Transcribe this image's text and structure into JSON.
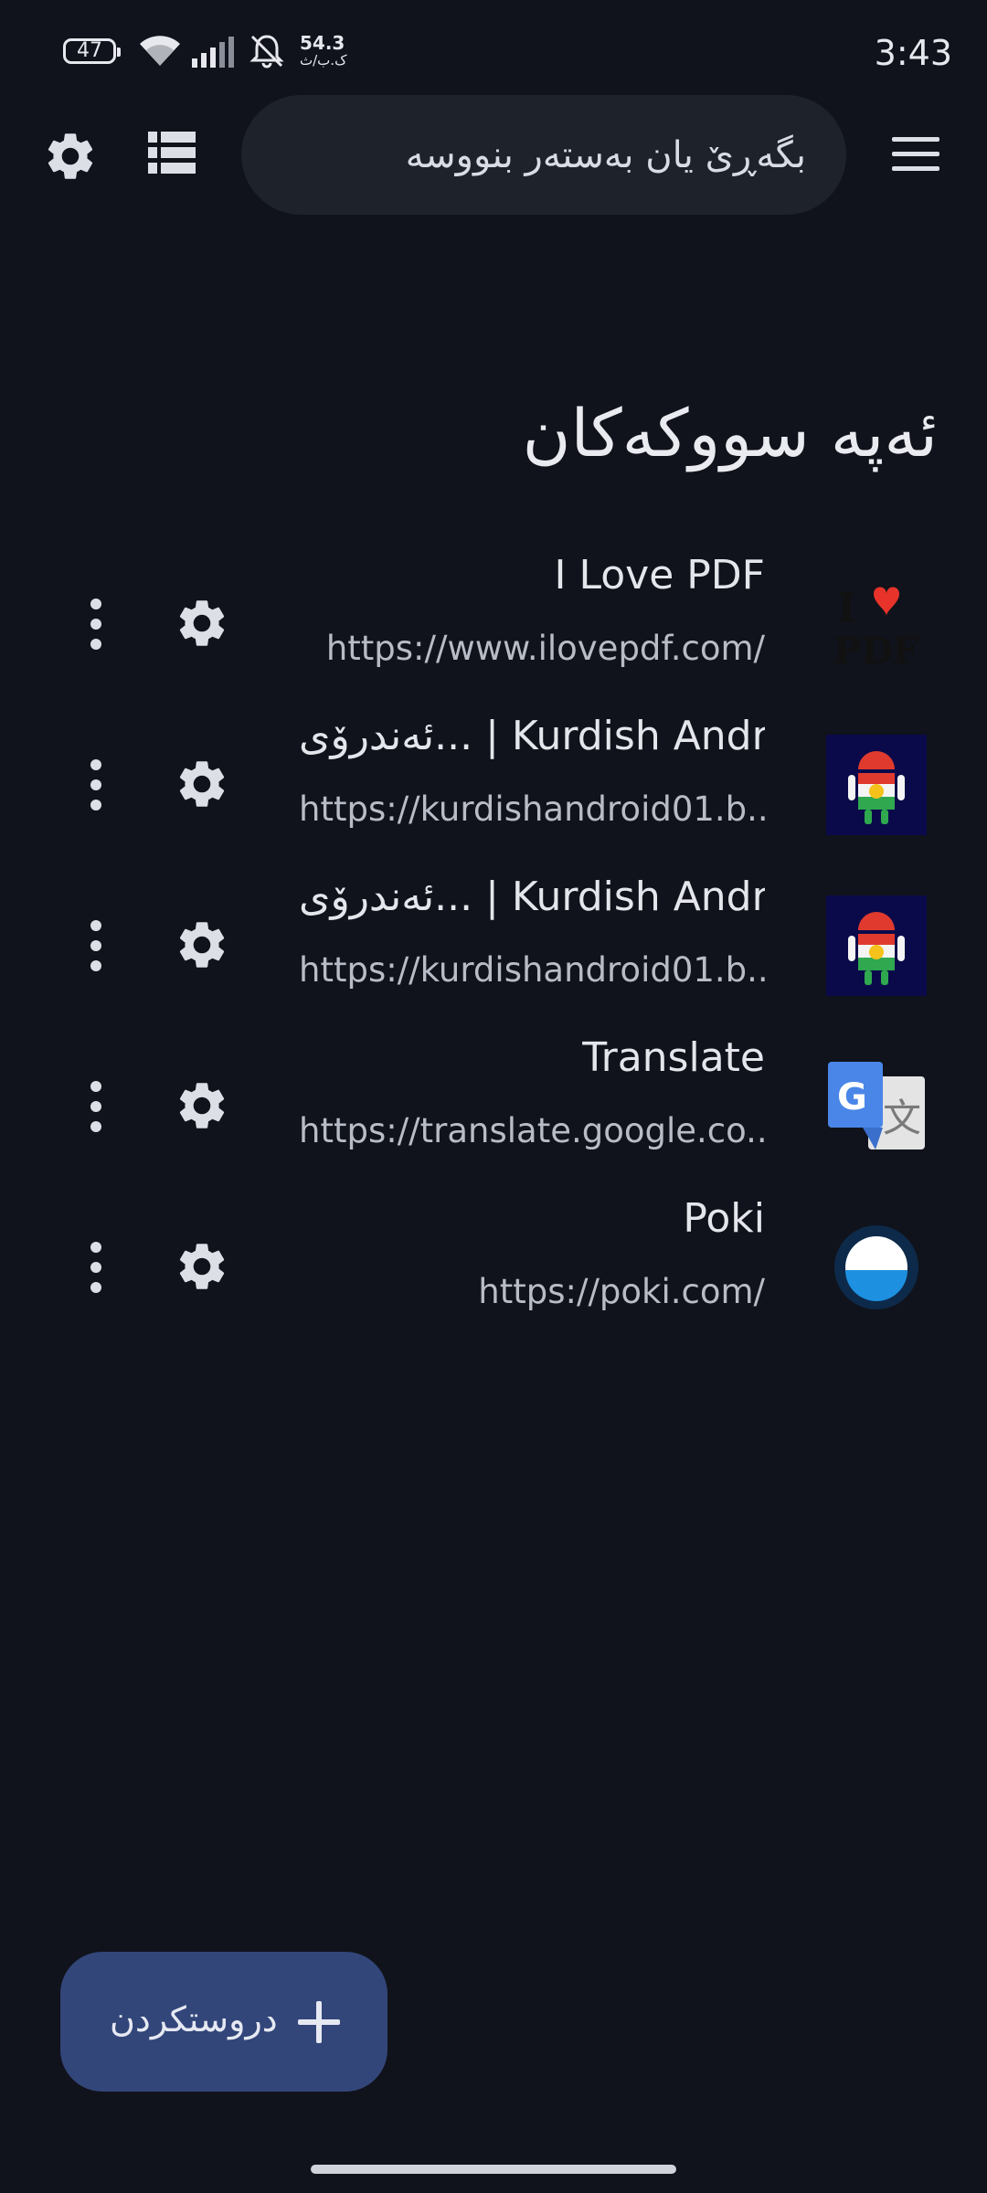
{
  "status_bar": {
    "battery": "47",
    "network_speed": "54.3",
    "network_unit": "ک.ب/ث",
    "time": "3:43"
  },
  "toolbar": {
    "search_placeholder": "بگەڕێ یان بەستەر بنووسە",
    "icons": [
      "settings-icon",
      "list-view-icon",
      "menu-icon"
    ]
  },
  "section": {
    "title": "ئەپە سووکەکان"
  },
  "shortcuts": [
    {
      "title": "I Love PDF",
      "url": "https://www.ilovepdf.com/",
      "icon": "ilovepdf-logo"
    },
    {
      "title": "ئەندرۆی... | Kurdish Android",
      "url": "https://kurdishandroid01.b...",
      "icon": "kurdish-android-logo"
    },
    {
      "title": "ئەندرۆی... | Kurdish Android",
      "url": "https://kurdishandroid01.b...",
      "icon": "kurdish-android-logo"
    },
    {
      "title": "Translate",
      "url": "https://translate.google.co...",
      "icon": "google-translate-logo"
    },
    {
      "title": "Poki",
      "url": "https://poki.com/",
      "icon": "poki-logo"
    }
  ],
  "fab": {
    "label": "دروستکردن",
    "icon": "plus-icon"
  },
  "colors": {
    "background": "#10131b",
    "search_bg": "#1e222b",
    "fab_bg": "#33467a"
  }
}
